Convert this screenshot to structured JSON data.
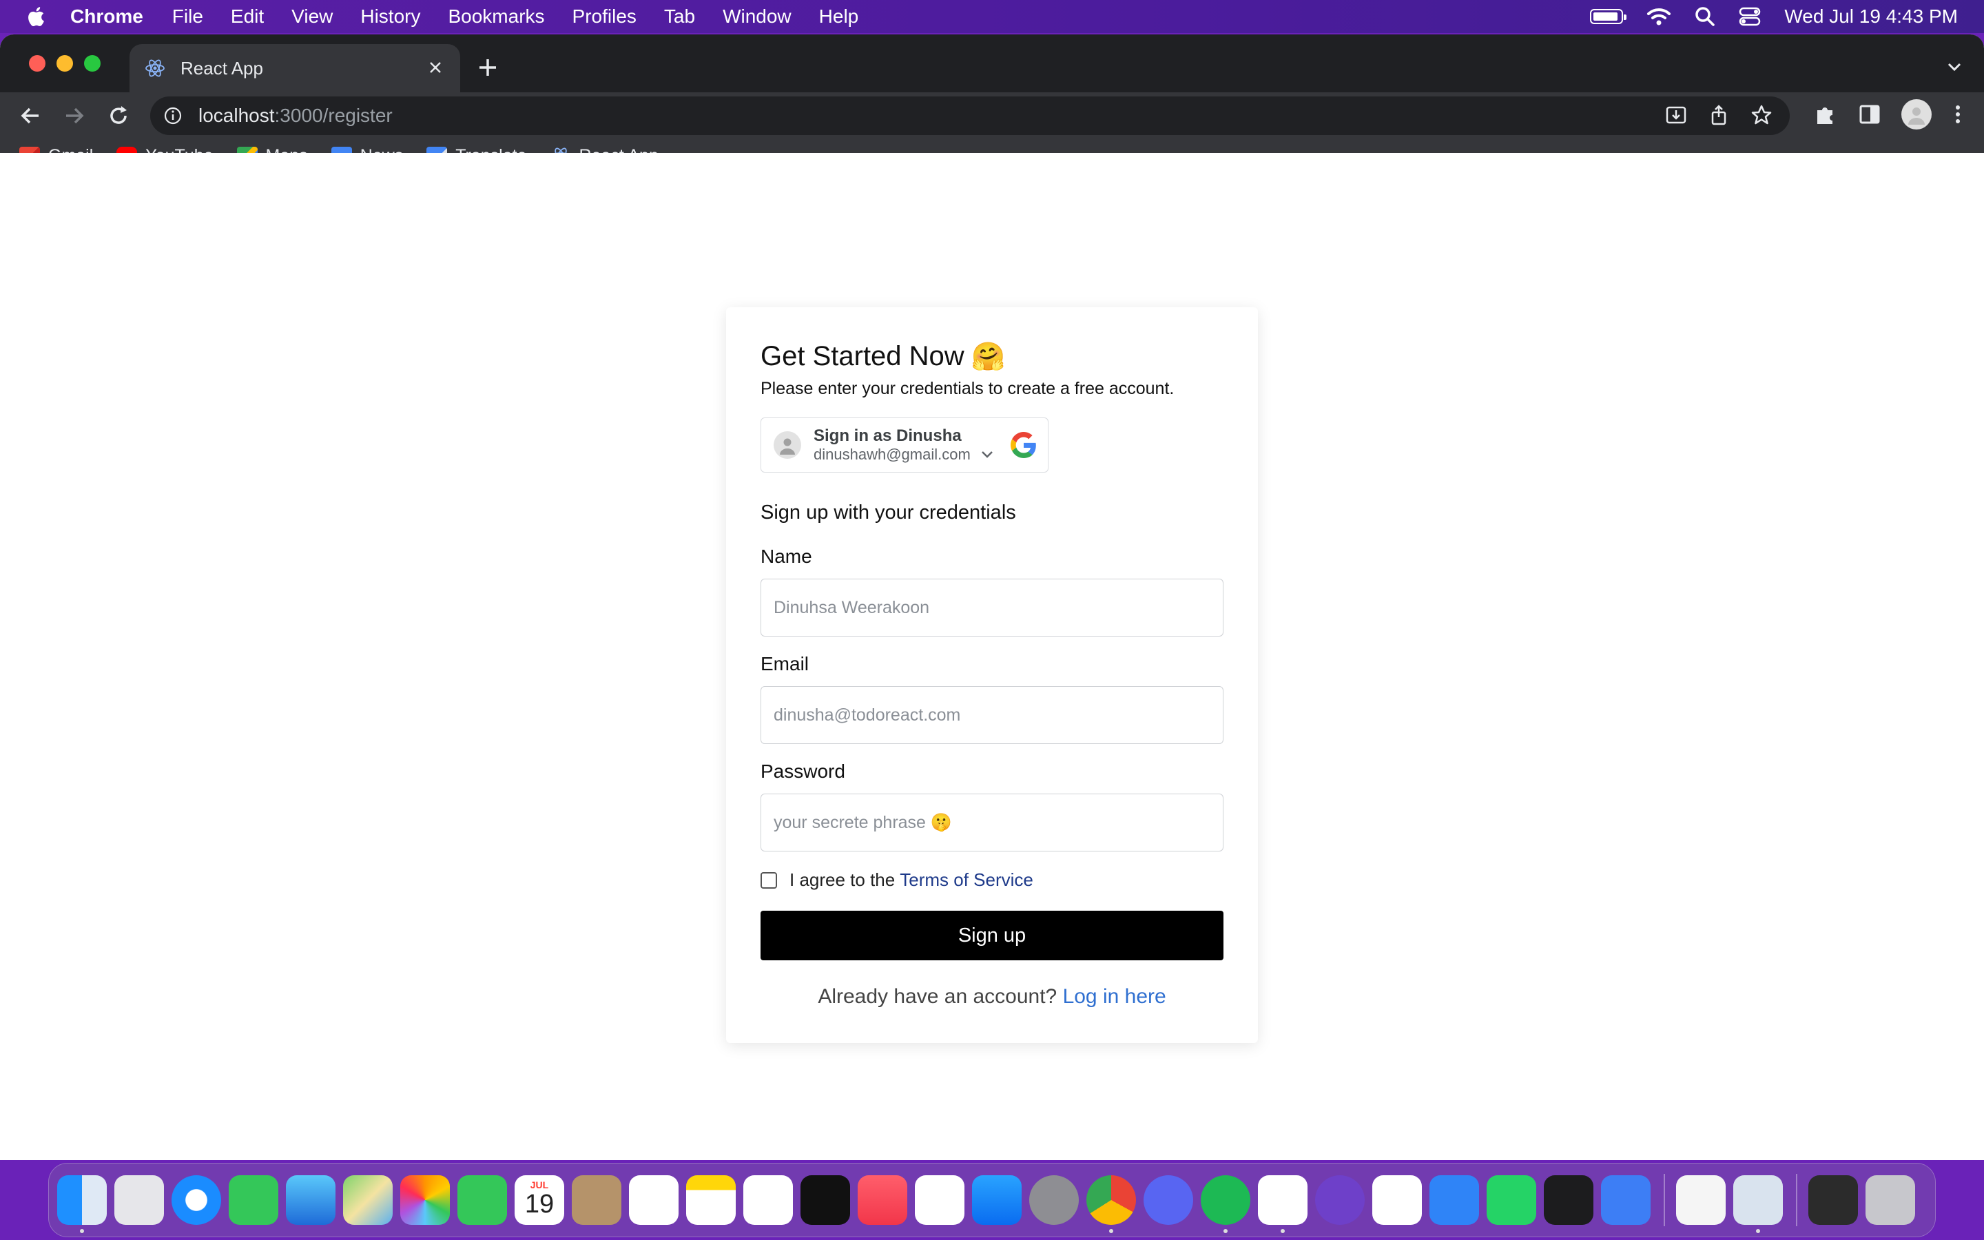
{
  "menubar": {
    "app_name": "Chrome",
    "menus": [
      "File",
      "Edit",
      "View",
      "History",
      "Bookmarks",
      "Profiles",
      "Tab",
      "Window",
      "Help"
    ],
    "datetime": "Wed Jul 19  4:43 PM"
  },
  "browser": {
    "tab_title": "React App",
    "url_host": "localhost",
    "url_path": ":3000/register",
    "bookmarks": [
      "Gmail",
      "YouTube",
      "Maps",
      "News",
      "Translate",
      "React App"
    ]
  },
  "page": {
    "heading": "Get Started Now",
    "heading_emoji": "🤗",
    "subheading": "Please enter your credentials to create a free account.",
    "google": {
      "title": "Sign in as Dinusha",
      "email": "dinushawh@gmail.com"
    },
    "section_title": "Sign up with your credentials",
    "name_label": "Name",
    "name_placeholder": "Dinuhsa Weerakoon",
    "email_label": "Email",
    "email_placeholder": "dinusha@todoreact.com",
    "password_label": "Password",
    "password_placeholder": "your secrete phrase 🤫",
    "agree_text": "I agree to the",
    "terms_link": "Terms of Service",
    "submit_label": "Sign up",
    "login_prompt": "Already have an account?",
    "login_link": "Log in here"
  },
  "dock": {
    "calendar_month": "JUL",
    "calendar_day": "19",
    "apps": [
      "finder-icon",
      "launchpad-icon",
      "safari-icon",
      "messages-icon",
      "mail-icon",
      "maps-icon",
      "photos-icon",
      "facetime-icon",
      "calendar-icon",
      "contacts-icon",
      "reminders-icon",
      "notes-icon",
      "freeform-icon",
      "tv-icon",
      "music-icon",
      "news-icon",
      "app-store-icon",
      "system-settings-icon",
      "chrome-icon",
      "discord-icon",
      "spotify-icon",
      "vscode-icon",
      "github-desktop-icon",
      "instruments-icon",
      "xcode-icon",
      "whatsapp-icon",
      "terminal-icon",
      "simulator-icon",
      "textedit-icon",
      "preview-icon",
      "screenshot-icon",
      "trash-icon"
    ]
  }
}
